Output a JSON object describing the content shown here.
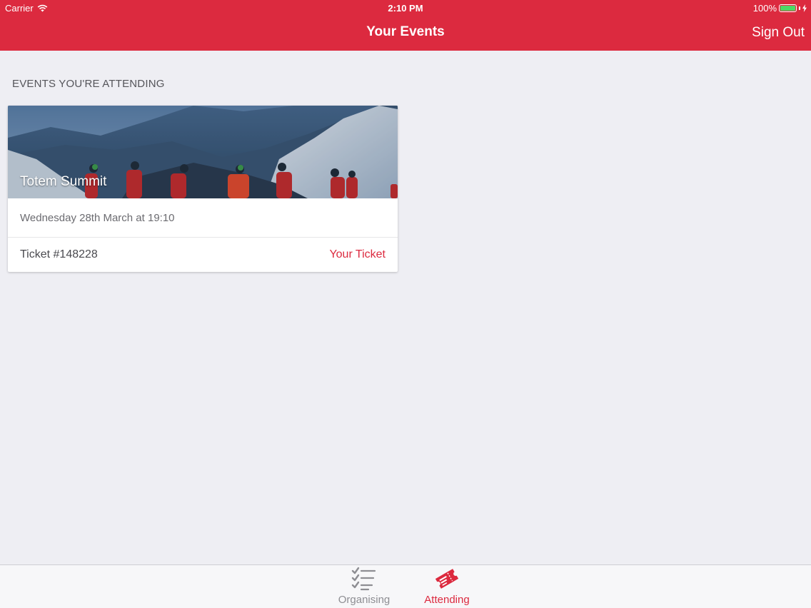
{
  "status_bar": {
    "carrier": "Carrier",
    "time": "2:10 PM",
    "battery": "100%",
    "battery_level": 1.0
  },
  "nav": {
    "title": "Your Events",
    "sign_out_label": "Sign Out"
  },
  "section": {
    "header": "EVENTS YOU'RE ATTENDING"
  },
  "events": [
    {
      "title": "Totem Summit",
      "date": "Wednesday 28th March at 19:10",
      "ticket": "Ticket #148228",
      "action_label": "Your Ticket"
    }
  ],
  "tabs": [
    {
      "label": "Organising",
      "icon": "checklist-icon",
      "selected": false
    },
    {
      "label": "Attending",
      "icon": "ticket-icon",
      "selected": true
    }
  ],
  "colors": {
    "brand": "#dc2a3f",
    "background": "#eeeef3",
    "battery": "#4cd964"
  }
}
